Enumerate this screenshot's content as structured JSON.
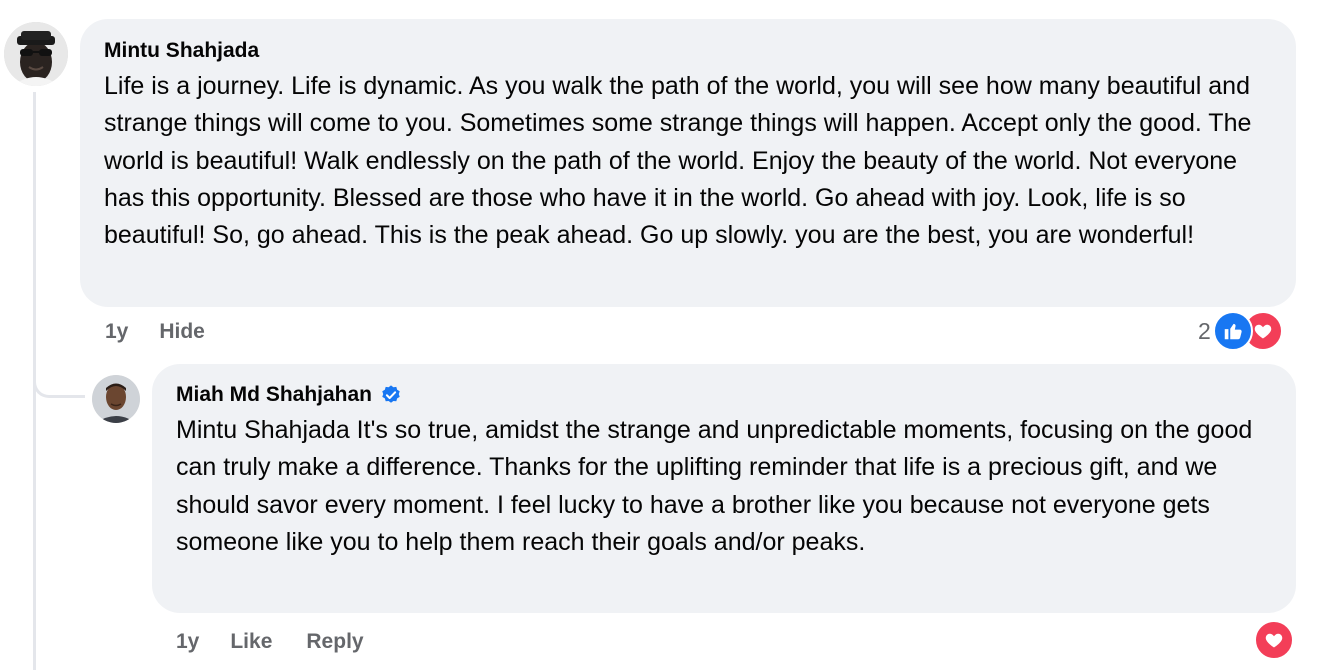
{
  "comments": [
    {
      "author": "Mintu Shahjada",
      "text": "Life is a journey. Life is dynamic. As you walk the path of the world, you will see how many beautiful and strange things will come to you. Sometimes some strange things will happen. Accept only the good. The world is beautiful! Walk endlessly on the path of the world. Enjoy the beauty of the world. Not everyone has this opportunity. Blessed are those who have it in the world. Go ahead with joy. Look, life is so beautiful! So, go ahead. This is the peak ahead. Go up slowly. you are the best, you are wonderful!",
      "time": "1y",
      "action": "Hide",
      "reaction_count": "2",
      "reactions": [
        "like-icon",
        "love-icon"
      ]
    },
    {
      "author": "Miah Md Shahjahan",
      "verified": true,
      "text": "Mintu Shahjada It's so true, amidst the strange and unpredictable moments, focusing on the good can truly make a difference. Thanks for the uplifting reminder that life is a precious gift, and we should savor every moment. I feel lucky to have a brother like you because not everyone gets someone like you to help them reach their goals and/or peaks.",
      "time": "1y",
      "like_label": "Like",
      "reply_label": "Reply",
      "reactions": [
        "love-icon"
      ]
    }
  ],
  "colors": {
    "bubble": "#f0f2f5",
    "meta_text": "#65676b",
    "like": "#1877f2",
    "love": "#f33e58",
    "verified": "#1877f2",
    "thread_line": "#e4e6eb"
  }
}
